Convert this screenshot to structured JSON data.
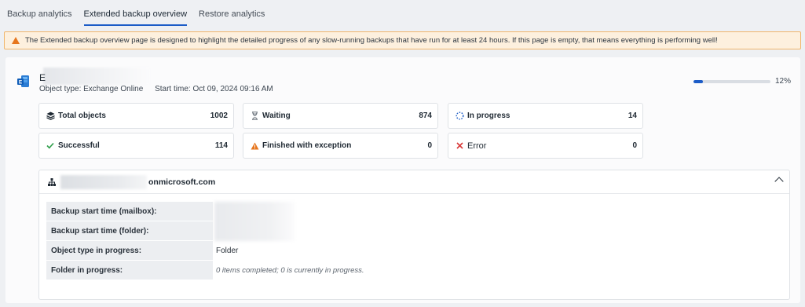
{
  "tabs": [
    {
      "label": "Backup analytics",
      "active": false
    },
    {
      "label": "Extended backup overview",
      "active": true
    },
    {
      "label": "Restore analytics",
      "active": false
    }
  ],
  "banner": {
    "text": "The Extended backup overview page is designed to highlight the detailed progress of any slow-running backups that have run for at least 24 hours. If this page is empty, that means everything is performing well!",
    "icon": "warning-icon",
    "color": "#e6761e"
  },
  "object": {
    "name": "E",
    "type_text": "Object type: Exchange Online",
    "start_text": "Start time: Oct 09, 2024 09:16 AM",
    "progress_percent": 12,
    "progress_label": "12%",
    "icon": "exchange-icon"
  },
  "stats": {
    "total": {
      "label": "Total objects",
      "value": "1002",
      "icon": "stack-icon"
    },
    "waiting": {
      "label": "Waiting",
      "value": "874",
      "icon": "hourglass-icon"
    },
    "in_progress": {
      "label": "In progress",
      "value": "14",
      "icon": "spinner-icon"
    },
    "successful": {
      "label": "Successful",
      "value": "114",
      "icon": "check-icon"
    },
    "exception": {
      "label": "Finished with exception",
      "value": "0",
      "icon": "warning-icon"
    },
    "error": {
      "label": "Error",
      "value": "0",
      "icon": "close-icon"
    }
  },
  "section": {
    "tenant_suffix": "onmicrosoft.com",
    "icon": "org-tree-icon",
    "details": [
      {
        "key": "Backup start time (mailbox):",
        "value": ""
      },
      {
        "key": "Backup start time (folder):",
        "value": ""
      },
      {
        "key": "Object type in progress:",
        "value": "Folder"
      },
      {
        "key": "Folder in progress:",
        "value": "0 items completed; 0 is currently in progress."
      }
    ]
  },
  "colors": {
    "accent": "#1c5cc7",
    "success": "#2e9e4a",
    "warning": "#e6761e",
    "error": "#d93a3a"
  }
}
